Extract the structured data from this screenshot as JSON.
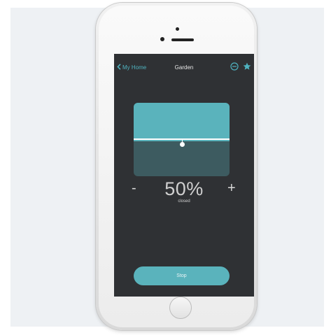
{
  "nav": {
    "back_label": "My Home",
    "title": "Garden"
  },
  "position": {
    "value": "50%",
    "status": "closed",
    "level": 0.5,
    "minus_label": "-",
    "plus_label": "+"
  },
  "actions": {
    "stop_label": "Stop"
  },
  "colors": {
    "accent": "#5ab3bc",
    "screen_bg": "#2f3134",
    "shade_dark": "#3d5b60"
  },
  "icons": [
    "chevron-left-icon",
    "minus-circle-icon",
    "star-icon"
  ]
}
